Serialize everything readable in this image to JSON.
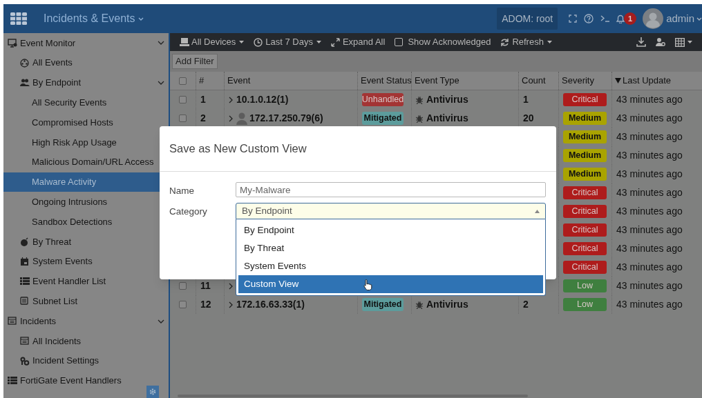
{
  "app": {
    "title": "Incidents & Events",
    "adom": "ADOM: root",
    "notification_count": "1",
    "user": "admin"
  },
  "sidebar": [
    {
      "label": "Event Monitor",
      "selected": false,
      "expanded": true,
      "children": [
        {
          "label": "All Events",
          "selected": false
        },
        {
          "label": "By Endpoint",
          "selected": false,
          "expanded": true,
          "children": [
            {
              "label": "All Security Events",
              "selected": false
            },
            {
              "label": "Compromised Hosts",
              "selected": false
            },
            {
              "label": "High Risk App Usage",
              "selected": false
            },
            {
              "label": "Malicious Domain/URL Access",
              "selected": false
            },
            {
              "label": "Malware Activity",
              "selected": true
            },
            {
              "label": "Ongoing Intrusions",
              "selected": false
            },
            {
              "label": "Sandbox Detections",
              "selected": false
            }
          ]
        },
        {
          "label": "By Threat",
          "selected": false
        },
        {
          "label": "System Events",
          "selected": false
        },
        {
          "label": "Event Handler List",
          "selected": false
        },
        {
          "label": "Subnet List",
          "selected": false
        }
      ]
    },
    {
      "label": "Incidents",
      "selected": false,
      "expanded": true,
      "children": [
        {
          "label": "All Incidents",
          "selected": false
        },
        {
          "label": "Incident Settings",
          "selected": false
        }
      ]
    },
    {
      "label": "FortiGate Event Handlers",
      "selected": false
    }
  ],
  "toolbar": [
    {
      "kind": "dropdown",
      "label": "All Devices"
    },
    {
      "kind": "dropdown",
      "label": "Last 7 Days"
    },
    {
      "kind": "button",
      "label": "Expand All"
    },
    {
      "kind": "checkbox",
      "label": "Show Acknowledged",
      "checked": false
    },
    {
      "kind": "dropdown",
      "label": "Refresh"
    }
  ],
  "filter_button": "Add Filter",
  "table": {
    "columns": [
      {
        "kind": "checkbox",
        "checked": false
      },
      {
        "kind": "text",
        "label": "#"
      },
      {
        "kind": "text",
        "label": "Event"
      },
      {
        "kind": "text",
        "label": "Event Status"
      },
      {
        "kind": "text",
        "label": "Event Type"
      },
      {
        "kind": "text",
        "label": "Count"
      },
      {
        "kind": "text",
        "label": "Severity"
      },
      {
        "kind": "text",
        "label": "Last Update",
        "sorted": true
      }
    ],
    "rows": [
      {
        "checked": false,
        "num": "1",
        "expandable": true,
        "user_icon": false,
        "event": "10.1.0.12(1)",
        "status": {
          "text": "Unhandled",
          "color": "#a33434"
        },
        "type": "Antivirus",
        "count": "1",
        "severity": {
          "text": "Critical",
          "color": "#ae1c1c"
        },
        "updated": "43 minutes ago"
      },
      {
        "checked": false,
        "num": "2",
        "expandable": true,
        "user_icon": true,
        "event": "172.17.250.79(6)",
        "status": {
          "text": "Mitigated",
          "color": "#5c9c9c"
        },
        "type": "Antivirus",
        "count": "20",
        "severity": {
          "text": "Medium",
          "color": "#a9a300"
        },
        "updated": "43 minutes ago"
      },
      {
        "severity": {
          "text": "Medium",
          "color": "#a9a300"
        },
        "updated": "43 minutes ago"
      },
      {
        "severity": {
          "text": "Medium",
          "color": "#a9a300"
        },
        "updated": "43 minutes ago"
      },
      {
        "severity": {
          "text": "Medium",
          "color": "#a9a300"
        },
        "updated": "43 minutes ago"
      },
      {
        "severity": {
          "text": "Critical",
          "color": "#ae1c1c"
        },
        "updated": "43 minutes ago"
      },
      {
        "severity": {
          "text": "Critical",
          "color": "#ae1c1c"
        },
        "updated": "43 minutes ago"
      },
      {
        "severity": {
          "text": "Critical",
          "color": "#ae1c1c"
        },
        "updated": "43 minutes ago"
      },
      {
        "severity": {
          "text": "Critical",
          "color": "#ae1c1c"
        },
        "updated": "43 minutes ago"
      },
      {
        "severity": {
          "text": "Critical",
          "color": "#ae1c1c"
        },
        "updated": "43 minutes ago"
      },
      {
        "checked": false,
        "num": "11",
        "expandable": true,
        "severity": {
          "text": "Low",
          "color": "#3f7f3f"
        },
        "updated": "43 minutes ago"
      },
      {
        "checked": false,
        "num": "12",
        "expandable": true,
        "user_icon": false,
        "event": "172.16.63.33(1)",
        "status": {
          "text": "Mitigated",
          "color": "#5c9c9c"
        },
        "type": "Antivirus",
        "count": "2",
        "severity": {
          "text": "Low",
          "color": "#3f7f3f"
        },
        "updated": "43 minutes ago"
      }
    ]
  },
  "dialog": {
    "title": "Save as New Custom View",
    "fields": [
      {
        "kind": "text",
        "label": "Name",
        "value": "My-Malware"
      },
      {
        "kind": "select",
        "label": "Category",
        "value": "By Endpoint",
        "expanded": true,
        "options": [
          {
            "label": "By Endpoint",
            "highlighted": false
          },
          {
            "label": "By Threat",
            "highlighted": false
          },
          {
            "label": "System Events",
            "highlighted": false
          },
          {
            "label": "Custom View",
            "highlighted": true
          }
        ]
      }
    ]
  }
}
